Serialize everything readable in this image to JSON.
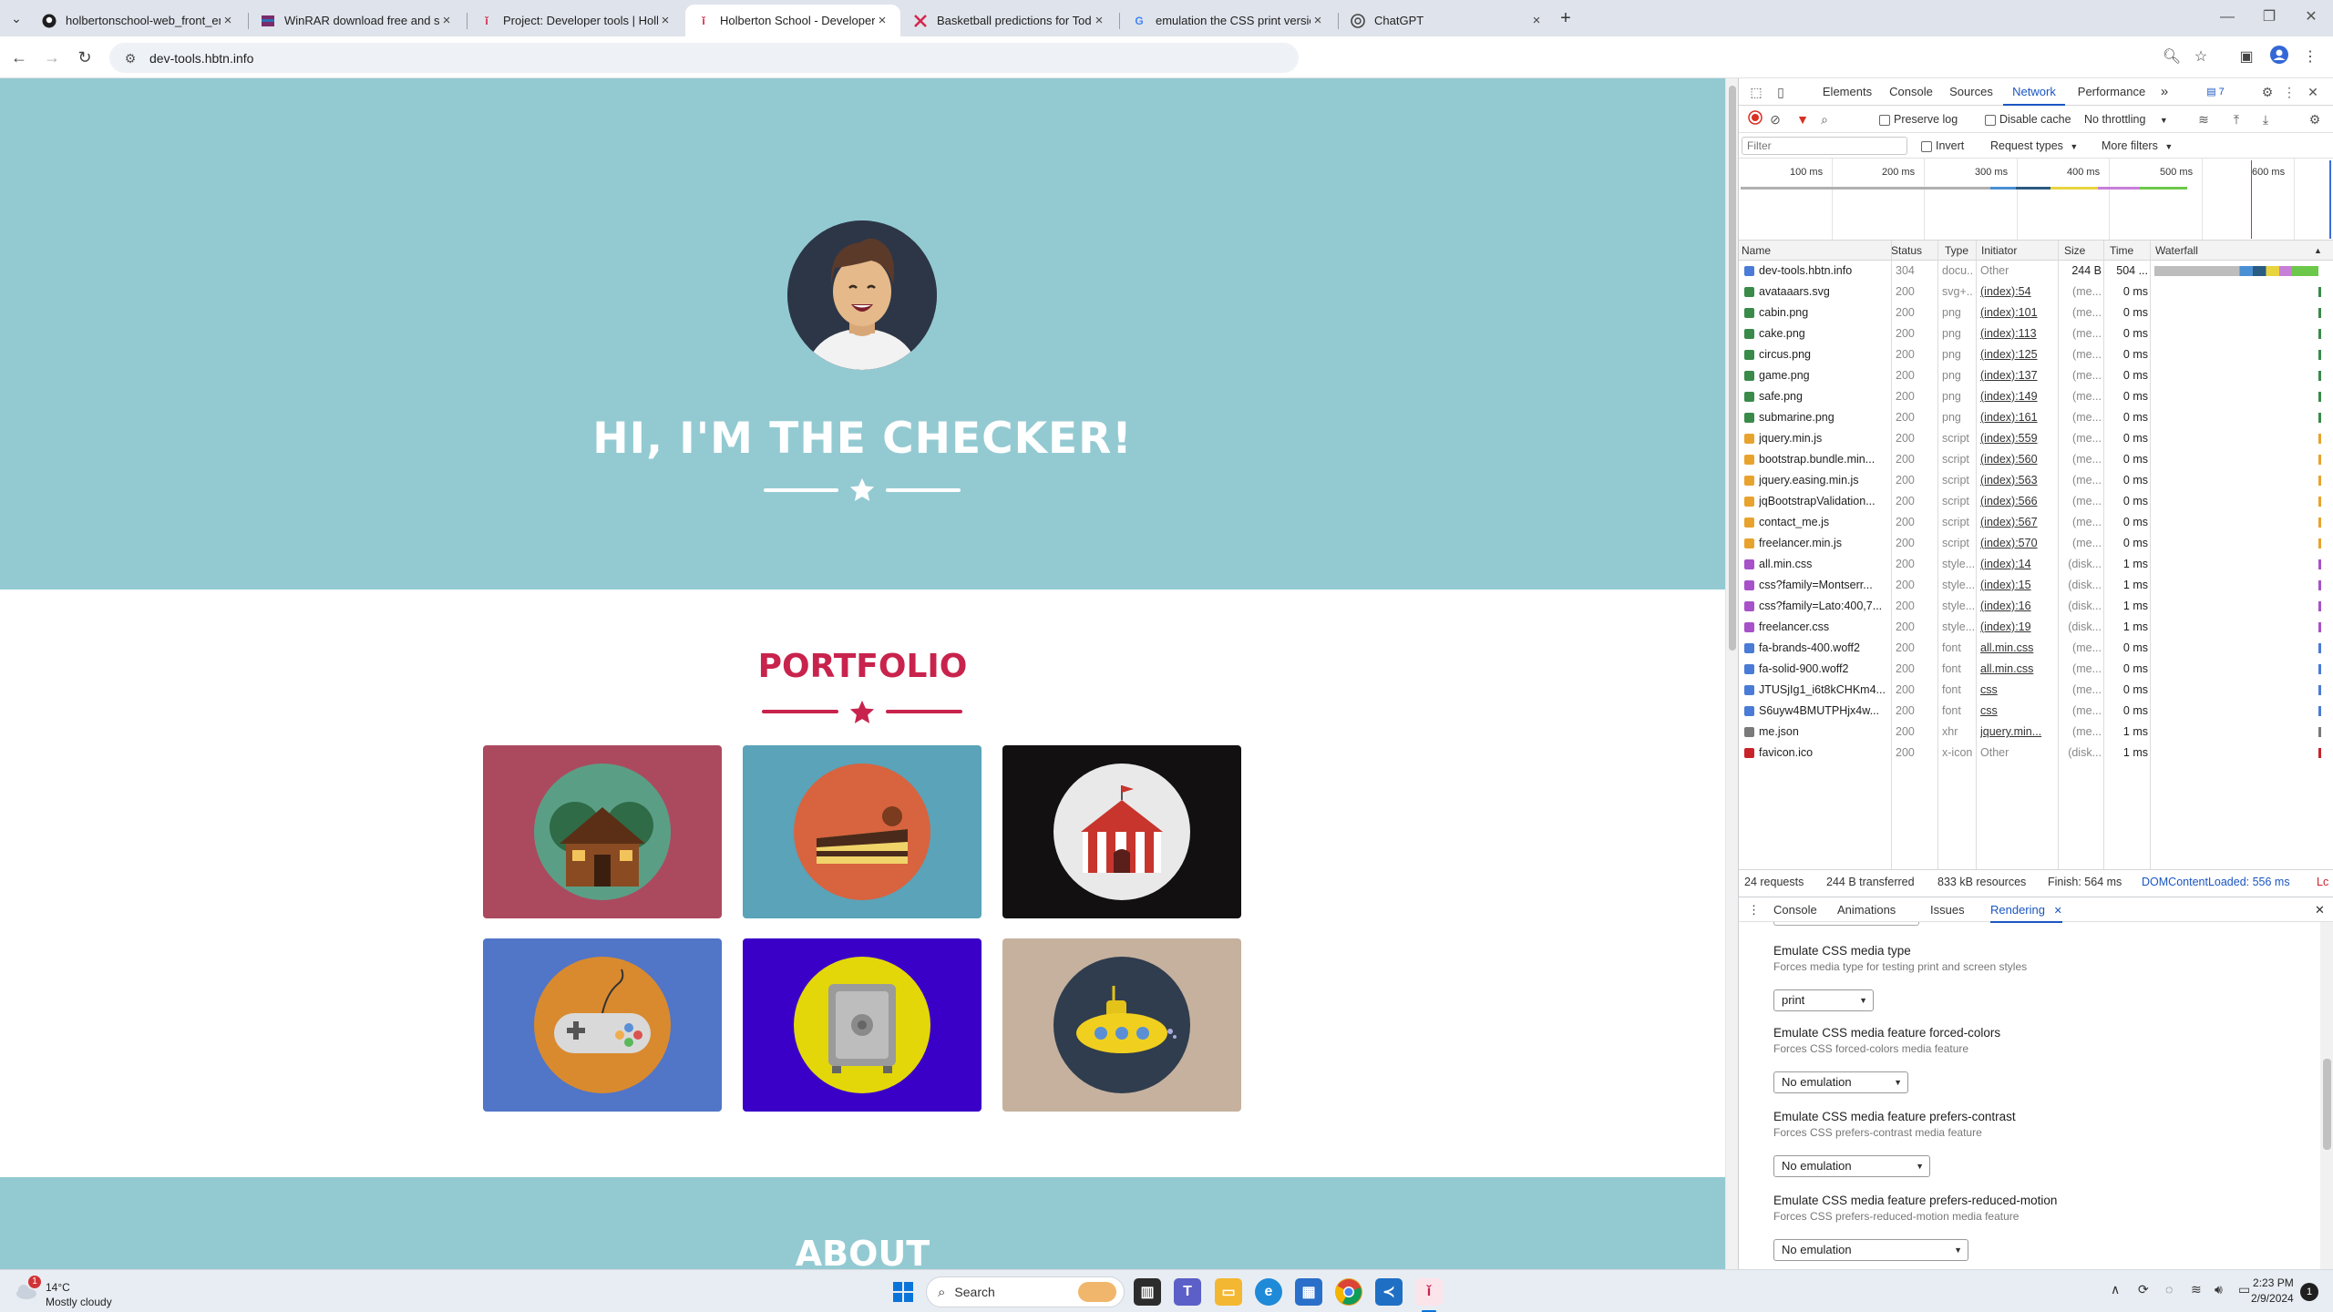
{
  "browser": {
    "tabs": [
      {
        "title": "holbertonschool-web_front_en",
        "favicon": "github-icon",
        "active": false
      },
      {
        "title": "WinRAR download free and su",
        "favicon": "winrar-icon",
        "active": false
      },
      {
        "title": "Project: Developer tools | Holb",
        "favicon": "holberton-icon",
        "active": false
      },
      {
        "title": "Holberton School - Developer t",
        "favicon": "holberton-icon",
        "active": true
      },
      {
        "title": "Basketball predictions for Toda",
        "favicon": "basketball-icon",
        "active": false
      },
      {
        "title": "emulation the CSS print version",
        "favicon": "google-icon",
        "active": false
      },
      {
        "title": "ChatGPT",
        "favicon": "chatgpt-icon",
        "active": false
      }
    ],
    "new_tab_symbol": "+",
    "url": "dev-tools.hbtn.info"
  },
  "page": {
    "hero_title": "HI, I'M THE CHECKER!",
    "portfolio_title": "PORTFOLIO",
    "about_title": "ABOUT",
    "colors": {
      "masthead": "#93cad2",
      "accent": "#c8234d"
    },
    "portfolio_items": [
      {
        "name": "cabin",
        "bg": "#ab4a5f",
        "circle": "#5a9f85"
      },
      {
        "name": "cake",
        "bg": "#5aa3b8",
        "circle": "#d8633f"
      },
      {
        "name": "circus",
        "bg": "#121010",
        "circle": "#e9e9e9"
      },
      {
        "name": "game",
        "bg": "#5175c7",
        "circle": "#d98a2f"
      },
      {
        "name": "safe",
        "bg": "#3a00c8",
        "circle": "#e3d70a"
      },
      {
        "name": "submarine",
        "bg": "#c5b19e",
        "circle": "#303d4e"
      }
    ]
  },
  "devtools": {
    "tabs": [
      "Elements",
      "Console",
      "Sources",
      "Network",
      "Performance"
    ],
    "active_tab": "Network",
    "overflow_symbol": "»",
    "issues_badge": "7",
    "toolbar": {
      "preserve_log": "Preserve log",
      "disable_cache": "Disable cache",
      "throttling": "No throttling"
    },
    "filter": {
      "placeholder": "Filter",
      "invert": "Invert",
      "request_types": "Request types",
      "more_filters": "More filters"
    },
    "overview_ticks": [
      "100 ms",
      "200 ms",
      "300 ms",
      "400 ms",
      "500 ms",
      "600 ms"
    ],
    "columns": [
      "Name",
      "Status",
      "Type",
      "Initiator",
      "Size",
      "Time",
      "Waterfall"
    ],
    "requests": [
      {
        "name": "dev-tools.hbtn.info",
        "status": "304",
        "type": "docu...",
        "initiator": "Other",
        "size": "244 B",
        "time": "504 ...",
        "icon": "document-icon"
      },
      {
        "name": "avataaars.svg",
        "status": "200",
        "type": "svg+...",
        "initiator": "(index):54",
        "size": "(me...",
        "time": "0 ms",
        "icon": "image-icon"
      },
      {
        "name": "cabin.png",
        "status": "200",
        "type": "png",
        "initiator": "(index):101",
        "size": "(me...",
        "time": "0 ms",
        "icon": "image-icon"
      },
      {
        "name": "cake.png",
        "status": "200",
        "type": "png",
        "initiator": "(index):113",
        "size": "(me...",
        "time": "0 ms",
        "icon": "image-icon"
      },
      {
        "name": "circus.png",
        "status": "200",
        "type": "png",
        "initiator": "(index):125",
        "size": "(me...",
        "time": "0 ms",
        "icon": "image-icon"
      },
      {
        "name": "game.png",
        "status": "200",
        "type": "png",
        "initiator": "(index):137",
        "size": "(me...",
        "time": "0 ms",
        "icon": "image-icon"
      },
      {
        "name": "safe.png",
        "status": "200",
        "type": "png",
        "initiator": "(index):149",
        "size": "(me...",
        "time": "0 ms",
        "icon": "image-icon"
      },
      {
        "name": "submarine.png",
        "status": "200",
        "type": "png",
        "initiator": "(index):161",
        "size": "(me...",
        "time": "0 ms",
        "icon": "image-icon"
      },
      {
        "name": "jquery.min.js",
        "status": "200",
        "type": "script",
        "initiator": "(index):559",
        "size": "(me...",
        "time": "0 ms",
        "icon": "script-icon"
      },
      {
        "name": "bootstrap.bundle.min...",
        "status": "200",
        "type": "script",
        "initiator": "(index):560",
        "size": "(me...",
        "time": "0 ms",
        "icon": "script-icon"
      },
      {
        "name": "jquery.easing.min.js",
        "status": "200",
        "type": "script",
        "initiator": "(index):563",
        "size": "(me...",
        "time": "0 ms",
        "icon": "script-icon"
      },
      {
        "name": "jqBootstrapValidation...",
        "status": "200",
        "type": "script",
        "initiator": "(index):566",
        "size": "(me...",
        "time": "0 ms",
        "icon": "script-icon"
      },
      {
        "name": "contact_me.js",
        "status": "200",
        "type": "script",
        "initiator": "(index):567",
        "size": "(me...",
        "time": "0 ms",
        "icon": "script-icon"
      },
      {
        "name": "freelancer.min.js",
        "status": "200",
        "type": "script",
        "initiator": "(index):570",
        "size": "(me...",
        "time": "0 ms",
        "icon": "script-icon"
      },
      {
        "name": "all.min.css",
        "status": "200",
        "type": "style...",
        "initiator": "(index):14",
        "size": "(disk...",
        "time": "1 ms",
        "icon": "stylesheet-icon"
      },
      {
        "name": "css?family=Montserr...",
        "status": "200",
        "type": "style...",
        "initiator": "(index):15",
        "size": "(disk...",
        "time": "1 ms",
        "icon": "stylesheet-icon"
      },
      {
        "name": "css?family=Lato:400,7...",
        "status": "200",
        "type": "style...",
        "initiator": "(index):16",
        "size": "(disk...",
        "time": "1 ms",
        "icon": "stylesheet-icon"
      },
      {
        "name": "freelancer.css",
        "status": "200",
        "type": "style...",
        "initiator": "(index):19",
        "size": "(disk...",
        "time": "1 ms",
        "icon": "stylesheet-icon"
      },
      {
        "name": "fa-brands-400.woff2",
        "status": "200",
        "type": "font",
        "initiator": "all.min.css",
        "size": "(me...",
        "time": "0 ms",
        "icon": "font-icon"
      },
      {
        "name": "fa-solid-900.woff2",
        "status": "200",
        "type": "font",
        "initiator": "all.min.css",
        "size": "(me...",
        "time": "0 ms",
        "icon": "font-icon"
      },
      {
        "name": "JTUSjIg1_i6t8kCHKm4...",
        "status": "200",
        "type": "font",
        "initiator": "css",
        "size": "(me...",
        "time": "0 ms",
        "icon": "font-icon"
      },
      {
        "name": "S6uyw4BMUTPHjx4w...",
        "status": "200",
        "type": "font",
        "initiator": "css",
        "size": "(me...",
        "time": "0 ms",
        "icon": "font-icon"
      },
      {
        "name": "me.json",
        "status": "200",
        "type": "xhr",
        "initiator": "jquery.min...",
        "size": "(me...",
        "time": "1 ms",
        "icon": "fetch-icon"
      },
      {
        "name": "favicon.ico",
        "status": "200",
        "type": "x-icon",
        "initiator": "Other",
        "size": "(disk...",
        "time": "1 ms",
        "icon": "favicon-icon"
      }
    ],
    "summary": {
      "requests": "24 requests",
      "transferred": "244 B transferred",
      "resources": "833 kB resources",
      "finish": "Finish: 564 ms",
      "domcontentloaded": "DOMContentLoaded: 556 ms",
      "load": "Lc"
    },
    "drawer_tabs": [
      "Console",
      "Animations",
      "Issues",
      "Rendering"
    ],
    "drawer_active": "Rendering",
    "rendering": [
      {
        "title": "Emulate CSS media type",
        "desc": "Forces media type for testing print and screen styles",
        "value": "print"
      },
      {
        "title": "Emulate CSS media feature forced-colors",
        "desc": "Forces CSS forced-colors media feature",
        "value": "No emulation"
      },
      {
        "title": "Emulate CSS media feature prefers-contrast",
        "desc": "Forces CSS prefers-contrast media feature",
        "value": "No emulation"
      },
      {
        "title": "Emulate CSS media feature prefers-reduced-motion",
        "desc": "Forces CSS prefers-reduced-motion media feature",
        "value": "No emulation"
      }
    ]
  },
  "taskbar": {
    "weather_temp": "14°C",
    "weather_desc": "Mostly cloudy",
    "weather_badge": "1",
    "search_placeholder": "Search",
    "time": "2:23 PM",
    "date": "2/9/2024",
    "notification_count": "1"
  }
}
